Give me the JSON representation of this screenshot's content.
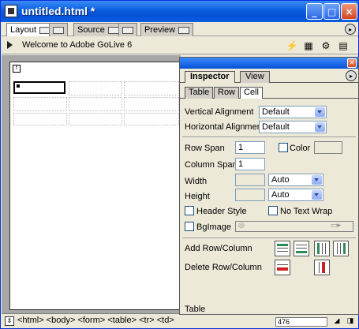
{
  "window": {
    "title": "untitled.html *",
    "buttons": {
      "minimize": "_",
      "maximize": "□",
      "close": "×"
    }
  },
  "doc_tabs": [
    {
      "label": "Layout",
      "active": true
    },
    {
      "label": "",
      "active": false
    },
    {
      "label": "Source",
      "active": false
    },
    {
      "label": "",
      "active": false
    },
    {
      "label": "Preview",
      "active": false
    }
  ],
  "toolbar": {
    "page_title": "Welcome to Adobe GoLive 6"
  },
  "canvas": {
    "form_marker": "f"
  },
  "statusbar": {
    "toggle": "⇕",
    "tag_path": "<html> <body> <form> <table> <tr> <td>",
    "size": "476"
  },
  "inspector": {
    "close": "×",
    "palette_tabs": [
      "Inspector",
      "View"
    ],
    "sub_tabs": [
      "Table",
      "Row",
      "Cell"
    ],
    "vertical_alignment": {
      "label": "Vertical Alignment",
      "value": "Default"
    },
    "horizontal_alignment": {
      "label": "Horizontal Alignment",
      "value": "Default"
    },
    "row_span": {
      "label": "Row Span",
      "value": "1"
    },
    "column_span": {
      "label": "Column Span",
      "value": "1"
    },
    "color": {
      "label": "Color",
      "checked": false
    },
    "width": {
      "label": "Width",
      "value": "",
      "unit": "Auto"
    },
    "height": {
      "label": "Height",
      "value": "",
      "unit": "Auto"
    },
    "header_style": {
      "label": "Header Style",
      "checked": false
    },
    "no_text_wrap": {
      "label": "No Text Wrap",
      "checked": false
    },
    "bgimage": {
      "label": "BgImage",
      "checked": false
    },
    "add_row_column": {
      "label": "Add Row/Column"
    },
    "delete_row_column": {
      "label": "Delete Row/Column"
    },
    "footer_label": "Table"
  }
}
